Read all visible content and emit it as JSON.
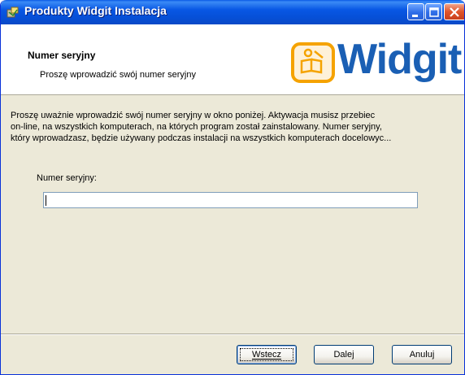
{
  "window": {
    "title": "Produkty Widgit Instalacja"
  },
  "header": {
    "title": "Numer seryjny",
    "subtitle": "Proszę wprowadzić swój numer seryjny",
    "logo_text": "Widgit",
    "logo_color": "#1a5fb4"
  },
  "body": {
    "instructions": [
      "Proszę uważnie wprowadzić swój numer seryjny w okno poniżej. Aktywacja musisz przebiec",
      "on-line, na wszystkich komputerach, na których program został zainstalowany. Numer seryjny,",
      "który wprowadzasz, będzie używany podczas instalacji na wszystkich komputerach docelowyc..."
    ],
    "serial_label": "Numer seryjny:",
    "serial_value": ""
  },
  "buttons": {
    "back": "Wstecz",
    "next": "Dalej",
    "cancel": "Anuluj"
  },
  "icons": {
    "app": "installer-icon",
    "minimize": "minimize-icon",
    "maximize": "maximize-icon",
    "close": "close-icon"
  }
}
